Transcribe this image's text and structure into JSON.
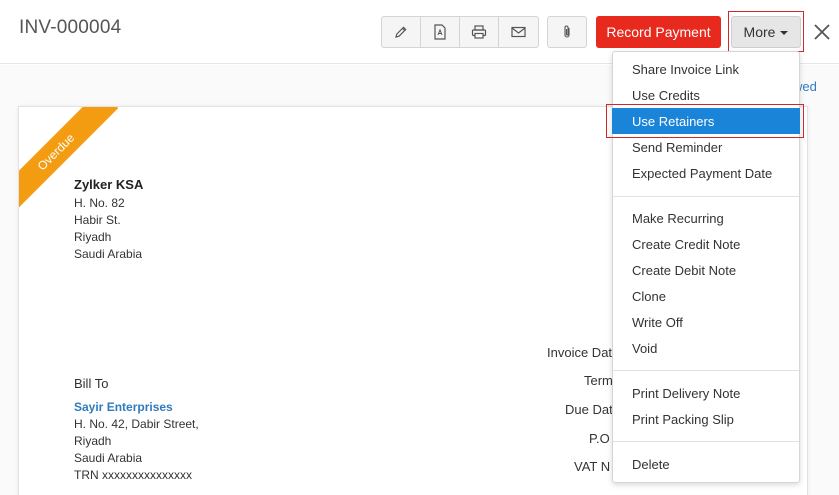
{
  "header": {
    "title": "INV-000004",
    "icons": [
      "pencil-icon",
      "pdf-icon",
      "printer-icon",
      "mail-icon",
      "paperclip-icon",
      "close-icon"
    ],
    "record_payment_label": "Record Payment",
    "more_label": "More"
  },
  "status": {
    "viewed_fragment": "wed",
    "ribbon_label": "Overdue",
    "ribbon_color": "#f39c12"
  },
  "organization": {
    "name": "Zylker KSA",
    "address": [
      "H. No. 82",
      "Habir St.",
      "Riyadh",
      "Saudi Arabia"
    ]
  },
  "bill_to": {
    "label": "Bill To",
    "customer_name": "Sayir Enterprises",
    "address": [
      "H. No. 42, Dabir Street,",
      "Riyadh",
      "Saudi Arabia",
      "TRN xxxxxxxxxxxxxxx"
    ]
  },
  "invoice_meta_labels": [
    "Invoice Dat",
    "Term",
    "Due Dat",
    "P.O",
    "VAT N"
  ],
  "more_menu": {
    "groups": [
      [
        "Share Invoice Link",
        "Use Credits",
        "Use Retainers",
        "Send Reminder",
        "Expected Payment Date"
      ],
      [
        "Make Recurring",
        "Create Credit Note",
        "Create Debit Note",
        "Clone",
        "Write Off",
        "Void"
      ],
      [
        "Print Delivery Note",
        "Print Packing Slip"
      ],
      [
        "Delete"
      ]
    ],
    "selected": "Use Retainers"
  },
  "colors": {
    "accent_red": "#e8291e",
    "highlight_blue": "#1a84d8",
    "link_blue": "#2f7bbf"
  }
}
